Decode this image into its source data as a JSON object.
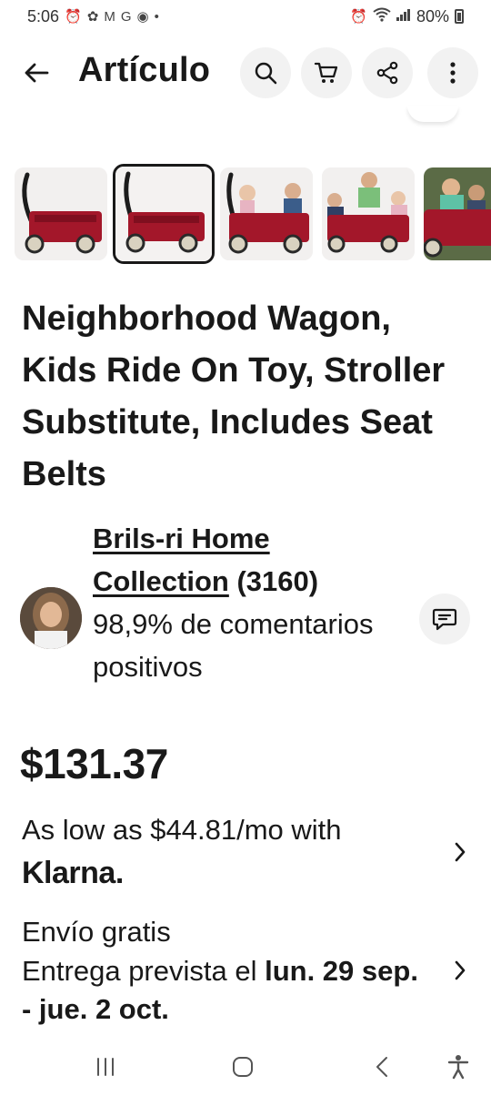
{
  "status_bar": {
    "time": "5:06",
    "left_icons": [
      "alarm-icon",
      "pinwheel-icon",
      "gmail-icon",
      "google-icon",
      "record-icon",
      "dot-icon"
    ],
    "right_icons": [
      "alarm-icon",
      "wifi-icon",
      "signal-icon"
    ],
    "battery": "80%"
  },
  "header": {
    "title": "Artículo",
    "buttons": [
      "search-icon",
      "cart-icon",
      "share-icon",
      "more-icon"
    ]
  },
  "thumbnails": {
    "count": 5,
    "selected_index": 1,
    "accent_color": "#a3172a"
  },
  "product": {
    "title": "Neighborhood Wagon, Kids Ride On Toy, Stroller Substitute, Includes Seat Belts",
    "price": "$131.37"
  },
  "seller": {
    "name": "Brils-ri Home Collection",
    "feedback_count": "(3160)",
    "rating": "98,9% de comentarios positivos"
  },
  "financing": {
    "text": "As low as $44.81/mo with",
    "provider": "Klarna."
  },
  "shipping": {
    "free": "Envío gratis",
    "estimate_prefix": "Entrega prevista el ",
    "estimate_dates": "lun. 29 sep. - jue. 2 oct."
  },
  "nav": {
    "buttons": [
      "recents-icon",
      "home-icon",
      "back-icon",
      "accessibility-icon"
    ]
  }
}
